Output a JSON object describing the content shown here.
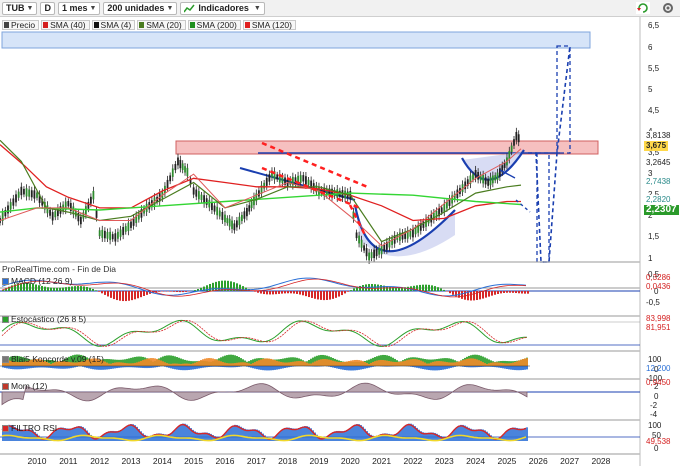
{
  "toolbar": {
    "ticker": "TUB",
    "chart_type_icon": "D",
    "period": "1 mes",
    "units": "200 unidades",
    "indicators_label": "Indicadores",
    "icons": [
      "candle-icon",
      "indicators-icon",
      "settings-icon",
      "refresh-icon"
    ]
  },
  "legend": [
    {
      "label": "Precio",
      "color": "#444444"
    },
    {
      "label": "SMA (40)",
      "color": "#d42020"
    },
    {
      "label": "SMA (4)",
      "color": "#111111"
    },
    {
      "label": "SMA (20)",
      "color": "#4a7c1f"
    },
    {
      "label": "SMA (200)",
      "color": "#1e8f1e"
    },
    {
      "label": "SMA (120)",
      "color": "#e02020"
    }
  ],
  "source_label": "ProRealTime.com - Fin de Dia",
  "price_axis": [
    "6,5",
    "6",
    "5,5",
    "5",
    "4,5",
    "4",
    "3,5",
    "3",
    "2,5",
    "2",
    "1,5",
    "1"
  ],
  "price_tags": [
    {
      "value": "3,8138",
      "color": "#ffffff"
    },
    {
      "value": "3,675",
      "color": "#ffd84a"
    },
    {
      "value": "3,2645",
      "color": "#ffffff"
    },
    {
      "value": "2,7438",
      "color": "#ffffff"
    },
    {
      "value": "2,2820",
      "color": "#ffffff"
    },
    {
      "value": "2,2307",
      "color": "#2a9a2a"
    }
  ],
  "years": [
    "2010",
    "2011",
    "2012",
    "2013",
    "2014",
    "2015",
    "2016",
    "2017",
    "2018",
    "2019",
    "2020",
    "2021",
    "2022",
    "2023",
    "2024",
    "2025",
    "2026",
    "2027",
    "2028"
  ],
  "panels": [
    {
      "name": "MACD (12 26 9)",
      "color": "#2a6fd6",
      "axis": [
        "0,5",
        "0",
        "-0,5"
      ],
      "tags": [
        "0,3286",
        "0,0436"
      ]
    },
    {
      "name": "Estocástico (26 8 5)",
      "color": "#2ca02c",
      "axis": [],
      "tags": [
        "83,998",
        "81,951"
      ]
    },
    {
      "name": "Blai5 Koncorde v.09 (15)",
      "color": "#777777",
      "axis": [
        "100",
        "0",
        "-100"
      ],
      "tags": [
        "12,200"
      ]
    },
    {
      "name": "Mom (12)",
      "color": "#c0392b",
      "axis": [
        "2",
        "0",
        "-2",
        "-4"
      ],
      "tags": [
        "0,9450"
      ]
    },
    {
      "name": "FILTRO RSI",
      "color": "#d62728",
      "axis": [
        "100",
        "50",
        "0"
      ],
      "tags": [
        "49,538"
      ]
    }
  ],
  "colors": {
    "accent": "#2a6fd6",
    "resistance_zone": "#f5b5b5",
    "target_zone": "#cfe0f7",
    "trendline_red": "#ff2020",
    "bowl": "#1a3fb0"
  }
}
